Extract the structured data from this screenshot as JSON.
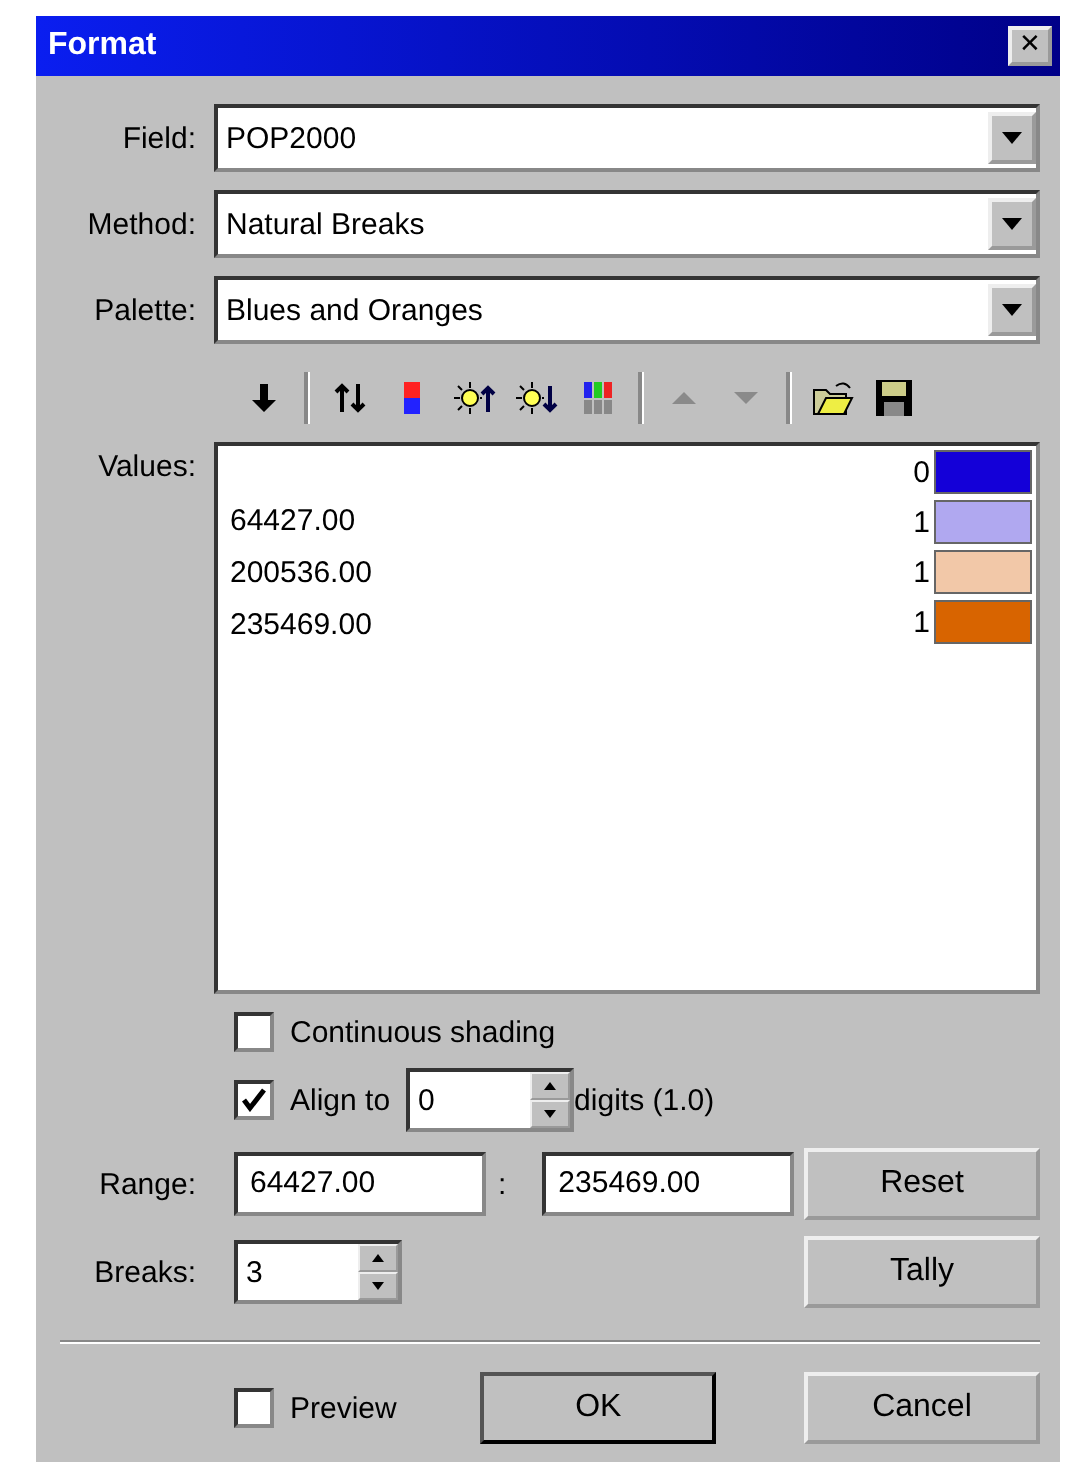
{
  "window": {
    "title": "Format",
    "close": "✕"
  },
  "field": {
    "label": "Field:",
    "value": "POP2000"
  },
  "method": {
    "label": "Method:",
    "value": "Natural Breaks"
  },
  "palette": {
    "label": "Palette:",
    "value": "Blues and Oranges"
  },
  "toolbar": [
    {
      "kind": "down",
      "disabled": false
    },
    {
      "kind": "sep"
    },
    {
      "kind": "swap",
      "disabled": false
    },
    {
      "kind": "gradient",
      "disabled": false
    },
    {
      "kind": "brighter",
      "disabled": false
    },
    {
      "kind": "darker",
      "disabled": false
    },
    {
      "kind": "bars",
      "disabled": false
    },
    {
      "kind": "sep"
    },
    {
      "kind": "up-arrow",
      "disabled": true
    },
    {
      "kind": "down-arrow",
      "disabled": true
    },
    {
      "kind": "sep"
    },
    {
      "kind": "open",
      "disabled": false
    },
    {
      "kind": "save",
      "disabled": false
    }
  ],
  "values": {
    "label": "Values:",
    "items": [
      "64427.00",
      "200536.00",
      "235469.00"
    ],
    "classes": [
      {
        "count": "0",
        "color": "#1400d8"
      },
      {
        "count": "1",
        "color": "#b0a8f0"
      },
      {
        "count": "1",
        "color": "#f2c8a8"
      },
      {
        "count": "1",
        "color": "#d86400"
      }
    ]
  },
  "continuous": {
    "label": "Continuous shading",
    "checked": false
  },
  "align": {
    "label": "Align to",
    "checked": true,
    "value": "0",
    "suffix": "digits (1.0)"
  },
  "range": {
    "label": "Range:",
    "from": "64427.00",
    "sep": ":",
    "to": "235469.00"
  },
  "breaks": {
    "label": "Breaks:",
    "value": "3"
  },
  "buttons": {
    "reset": "Reset",
    "tally": "Tally",
    "ok": "OK",
    "cancel": "Cancel"
  },
  "preview": {
    "label": "Preview",
    "checked": false
  }
}
